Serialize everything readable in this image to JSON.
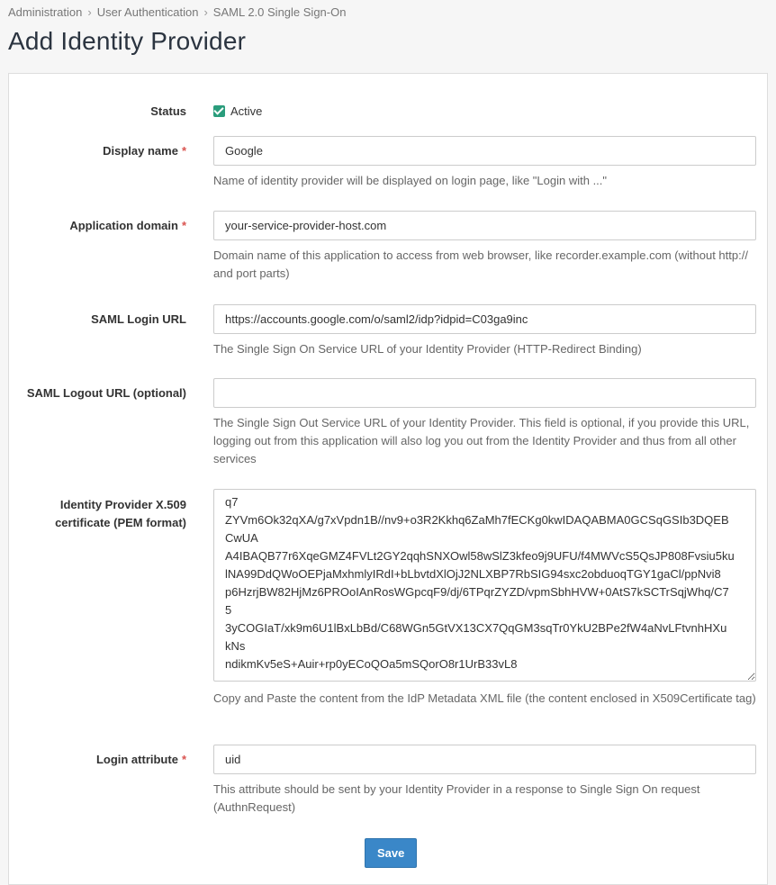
{
  "breadcrumb": [
    "Administration",
    "User Authentication",
    "SAML 2.0 Single Sign-On"
  ],
  "title": "Add Identity Provider",
  "form": {
    "status": {
      "label": "Status",
      "value": "Active",
      "checked": true
    },
    "display_name": {
      "label": "Display name",
      "value": "Google",
      "help": "Name of identity provider will be displayed on login page, like \"Login with ...\""
    },
    "app_domain": {
      "label": "Application domain",
      "value": "your-service-provider-host.com",
      "help": "Domain name of this application to access from web browser, like recorder.example.com (without http:// and port parts)"
    },
    "login_url": {
      "label": "SAML Login URL",
      "value": "https://accounts.google.com/o/saml2/idp?idpid=C03ga9inc",
      "help": "The Single Sign On Service URL of your Identity Provider (HTTP-Redirect Binding)"
    },
    "logout_url": {
      "label": "SAML Logout URL (optional)",
      "value": "",
      "help": "The Single Sign Out Service URL of your Identity Provider. This field is optional, if you provide this URL, logging out from this application will also log you out from the Identity Provider and thus from all other services"
    },
    "certificate": {
      "label": "Identity Provider X.509 certificate (PEM format)",
      "value": "q7\nZYVm6Ok32qXA/g7xVpdn1B//nv9+o3R2Kkhq6ZaMh7fECKg0kwIDAQABMA0GCSqGSIb3DQEB\nCwUA\nA4IBAQB77r6XqeGMZ4FVLt2GY2qqhSNXOwl58wSlZ3kfeo9j9UFU/f4MWVcS5QsJP808Fvsiu5ku\nlNA99DdQWoOEPjaMxhmlyIRdI+bLbvtdXlOjJ2NLXBP7RbSIG94sxc2obduoqTGY1gaCl/ppNvi8\np6HzrjBW82HjMz6PROoIAnRosWGpcqF9/dj/6TPqrZYZD/vpmSbhHVW+0AtS7kSCTrSqjWhq/C7\n5\n3yCOGIaT/xk9m6U1lBxLbBd/C68WGn5GtVX13CX7QqGM3sqTr0YkU2BPe2fW4aNvLFtvnhHXu\nkNs\nndikmKv5eS+Auir+rp0yECoQOa5mSQorO8r1UrB33vL8",
      "help": "Copy and Paste the content from the IdP Metadata XML file (the content enclosed in X509Certificate tag)"
    },
    "login_attribute": {
      "label": "Login attribute",
      "value": "uid",
      "help": "This attribute should be sent by your Identity Provider in a response to Single Sign On request (AuthnRequest)"
    },
    "required_marker": "*",
    "save_label": "Save"
  },
  "colors": {
    "accent": "#3a87c8",
    "required": "#d9534f",
    "check": "#2a9d7c"
  }
}
